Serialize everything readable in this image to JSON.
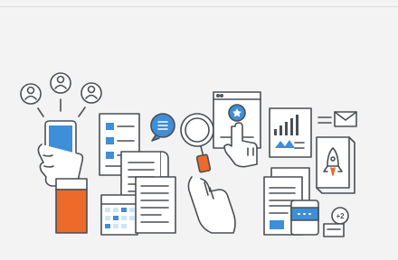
{
  "illustration": {
    "badge_text": "+2",
    "palette": {
      "line": "#4a4f55",
      "blue": "#3e8ed8",
      "light_blue": "#cfe4f7",
      "orange": "#ee6a2a",
      "white": "#ffffff",
      "bg": "#f3f3f3"
    },
    "icons": [
      "user-icon",
      "user-icon",
      "user-icon",
      "smartphone-icon",
      "checklist-icon",
      "chat-bubble-icon",
      "document-scroll-icon",
      "magnifier-icon",
      "browser-star-icon",
      "bar-chart-icon",
      "envelope-icon",
      "rocket-icon",
      "calendar-icon",
      "card-icon"
    ]
  }
}
